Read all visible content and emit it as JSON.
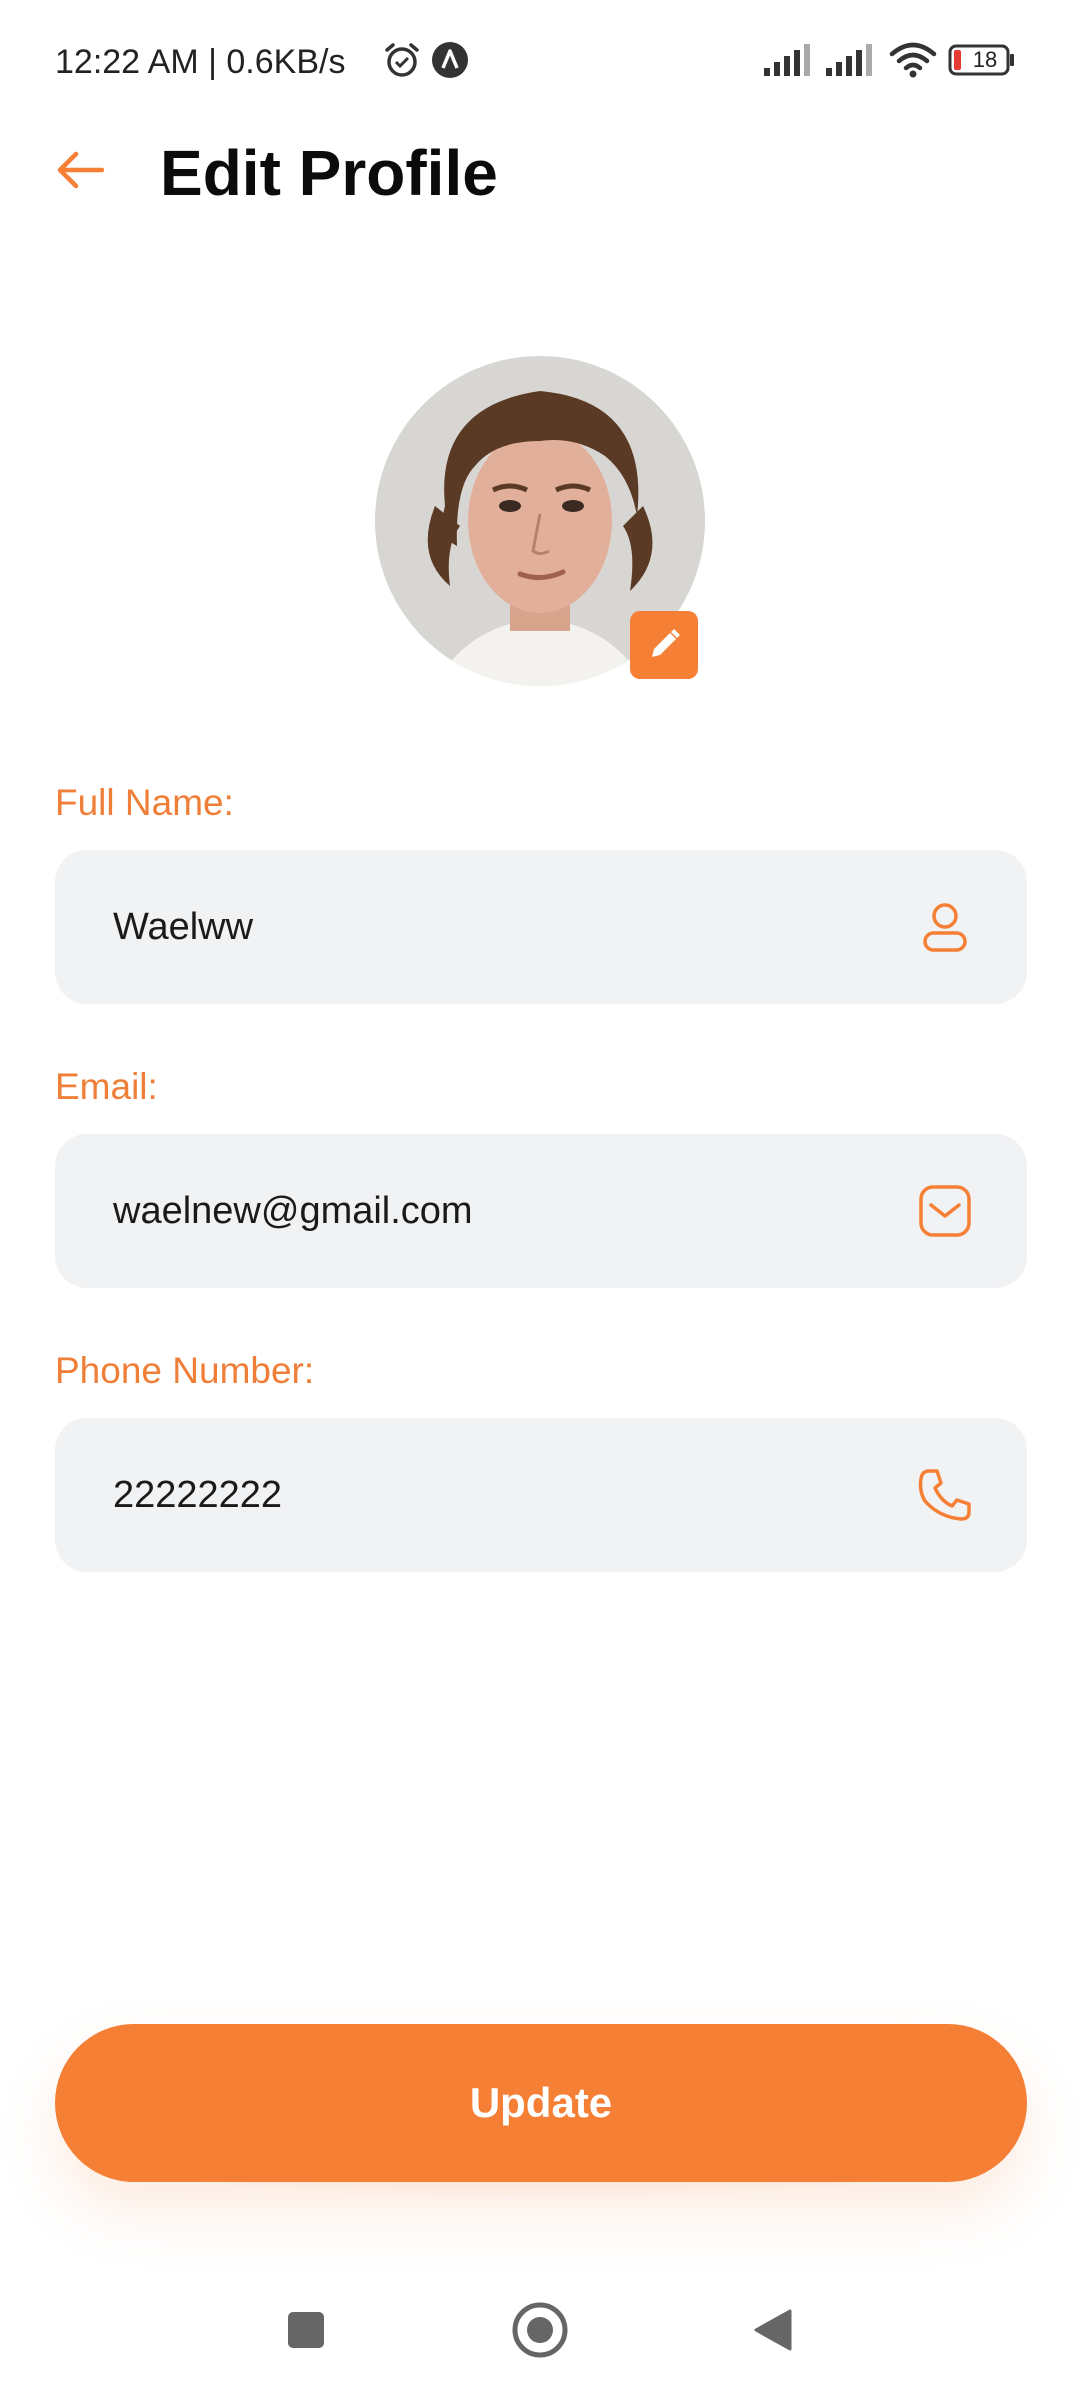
{
  "status_bar": {
    "time": "12:22 AM | 0.6KB/s",
    "battery_level": "18",
    "icons": [
      "alarm-icon",
      "app-a-icon",
      "signal-icon",
      "signal-icon",
      "wifi-icon",
      "battery-icon"
    ]
  },
  "header": {
    "title": "Edit Profile",
    "back_icon": "arrow-left-icon"
  },
  "avatar": {
    "edit_icon": "pencil-icon"
  },
  "form": {
    "full_name": {
      "label": "Full Name:",
      "value": "Waelww",
      "icon": "person-icon"
    },
    "email": {
      "label": "Email:",
      "value": "waelnew@gmail.com",
      "icon": "mail-icon"
    },
    "phone": {
      "label": "Phone Number:",
      "value": "22222222",
      "icon": "phone-icon"
    }
  },
  "actions": {
    "update_label": "Update"
  },
  "nav_bar": {
    "items": [
      "recents-icon",
      "home-icon",
      "back-triangle-icon"
    ]
  },
  "colors": {
    "accent": "#f47f35",
    "field_background": "#f1f2f4",
    "label": "#ef7f38",
    "battery_low": "#e53935"
  }
}
